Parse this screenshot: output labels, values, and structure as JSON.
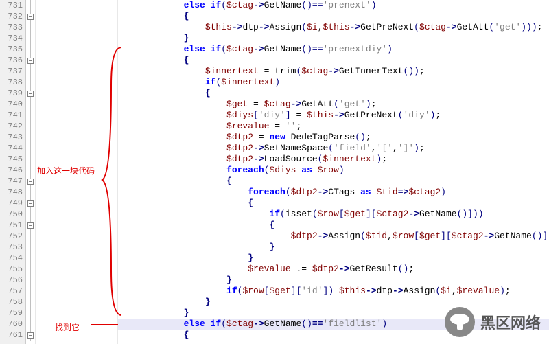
{
  "annotations": {
    "add_block": "加入这一块代码",
    "found_it": "找到它"
  },
  "watermark": "黑区网络",
  "line_numbers": [
    731,
    732,
    733,
    734,
    735,
    736,
    737,
    738,
    739,
    740,
    741,
    742,
    743,
    744,
    745,
    746,
    747,
    748,
    749,
    750,
    751,
    752,
    753,
    754,
    755,
    756,
    757,
    758,
    759,
    760,
    761
  ],
  "lines": [
    {
      "n": 731,
      "indent": 3,
      "tokens": [
        [
          "kw",
          "else if"
        ],
        [
          "paren",
          "("
        ],
        [
          "var",
          "$ctag"
        ],
        [
          "op",
          "->"
        ],
        [
          "func",
          "GetName"
        ],
        [
          "paren",
          "()"
        ],
        [
          "op",
          "=="
        ],
        [
          "str",
          "'prenext'"
        ],
        [
          "paren",
          ")"
        ]
      ]
    },
    {
      "n": 732,
      "indent": 3,
      "tokens": [
        [
          "brace",
          "{"
        ]
      ]
    },
    {
      "n": 733,
      "indent": 4,
      "tokens": [
        [
          "var",
          "$this"
        ],
        [
          "op",
          "->"
        ],
        [
          "func",
          "dtp"
        ],
        [
          "op",
          "->"
        ],
        [
          "func",
          "Assign"
        ],
        [
          "paren",
          "("
        ],
        [
          "var",
          "$i"
        ],
        [
          "norm",
          ","
        ],
        [
          "var",
          "$this"
        ],
        [
          "op",
          "->"
        ],
        [
          "func",
          "GetPreNext"
        ],
        [
          "paren",
          "("
        ],
        [
          "var",
          "$ctag"
        ],
        [
          "op",
          "->"
        ],
        [
          "func",
          "GetAtt"
        ],
        [
          "paren",
          "("
        ],
        [
          "str",
          "'get'"
        ],
        [
          "paren",
          ")))"
        ],
        [
          "norm",
          ";"
        ]
      ]
    },
    {
      "n": 734,
      "indent": 3,
      "tokens": [
        [
          "brace",
          "}"
        ]
      ]
    },
    {
      "n": 735,
      "indent": 3,
      "tokens": [
        [
          "kw",
          "else if"
        ],
        [
          "paren",
          "("
        ],
        [
          "var",
          "$ctag"
        ],
        [
          "op",
          "->"
        ],
        [
          "func",
          "GetName"
        ],
        [
          "paren",
          "()"
        ],
        [
          "op",
          "=="
        ],
        [
          "str",
          "'prenextdiy'"
        ],
        [
          "paren",
          ")"
        ]
      ]
    },
    {
      "n": 736,
      "indent": 3,
      "tokens": [
        [
          "brace",
          "{"
        ]
      ]
    },
    {
      "n": 737,
      "indent": 4,
      "tokens": [
        [
          "var",
          "$innertext"
        ],
        [
          "norm",
          " = "
        ],
        [
          "func",
          "trim"
        ],
        [
          "paren",
          "("
        ],
        [
          "var",
          "$ctag"
        ],
        [
          "op",
          "->"
        ],
        [
          "func",
          "GetInnerText"
        ],
        [
          "paren",
          "())"
        ],
        [
          "norm",
          ";"
        ]
      ]
    },
    {
      "n": 738,
      "indent": 4,
      "tokens": [
        [
          "kw",
          "if"
        ],
        [
          "paren",
          "("
        ],
        [
          "var",
          "$innertext"
        ],
        [
          "paren",
          ")"
        ]
      ]
    },
    {
      "n": 739,
      "indent": 4,
      "tokens": [
        [
          "brace",
          "{"
        ]
      ]
    },
    {
      "n": 740,
      "indent": 5,
      "tokens": [
        [
          "var",
          "$get"
        ],
        [
          "norm",
          " = "
        ],
        [
          "var",
          "$ctag"
        ],
        [
          "op",
          "->"
        ],
        [
          "func",
          "GetAtt"
        ],
        [
          "paren",
          "("
        ],
        [
          "str",
          "'get'"
        ],
        [
          "paren",
          ")"
        ],
        [
          "norm",
          ";"
        ]
      ]
    },
    {
      "n": 741,
      "indent": 5,
      "tokens": [
        [
          "var",
          "$diys"
        ],
        [
          "paren",
          "["
        ],
        [
          "str",
          "'diy'"
        ],
        [
          "paren",
          "]"
        ],
        [
          "norm",
          " = "
        ],
        [
          "var",
          "$this"
        ],
        [
          "op",
          "->"
        ],
        [
          "func",
          "GetPreNext"
        ],
        [
          "paren",
          "("
        ],
        [
          "str",
          "'diy'"
        ],
        [
          "paren",
          ")"
        ],
        [
          "norm",
          ";"
        ]
      ]
    },
    {
      "n": 742,
      "indent": 5,
      "tokens": [
        [
          "var",
          "$revalue"
        ],
        [
          "norm",
          " = "
        ],
        [
          "str",
          "''"
        ],
        [
          "norm",
          ";"
        ]
      ]
    },
    {
      "n": 743,
      "indent": 5,
      "tokens": [
        [
          "var",
          "$dtp2"
        ],
        [
          "norm",
          " = "
        ],
        [
          "kw",
          "new"
        ],
        [
          "norm",
          " "
        ],
        [
          "func",
          "DedeTagParse"
        ],
        [
          "paren",
          "()"
        ],
        [
          "norm",
          ";"
        ]
      ]
    },
    {
      "n": 744,
      "indent": 5,
      "tokens": [
        [
          "var",
          "$dtp2"
        ],
        [
          "op",
          "->"
        ],
        [
          "func",
          "SetNameSpace"
        ],
        [
          "paren",
          "("
        ],
        [
          "str",
          "'field'"
        ],
        [
          "norm",
          ","
        ],
        [
          "str",
          "'['"
        ],
        [
          "norm",
          ","
        ],
        [
          "str",
          "']'"
        ],
        [
          "paren",
          ")"
        ],
        [
          "norm",
          ";"
        ]
      ]
    },
    {
      "n": 745,
      "indent": 5,
      "tokens": [
        [
          "var",
          "$dtp2"
        ],
        [
          "op",
          "->"
        ],
        [
          "func",
          "LoadSource"
        ],
        [
          "paren",
          "("
        ],
        [
          "var",
          "$innertext"
        ],
        [
          "paren",
          ")"
        ],
        [
          "norm",
          ";"
        ]
      ]
    },
    {
      "n": 746,
      "indent": 5,
      "tokens": [
        [
          "kw",
          "foreach"
        ],
        [
          "paren",
          "("
        ],
        [
          "var",
          "$diys"
        ],
        [
          "norm",
          " "
        ],
        [
          "kw",
          "as"
        ],
        [
          "norm",
          " "
        ],
        [
          "var",
          "$row"
        ],
        [
          "paren",
          ")"
        ]
      ]
    },
    {
      "n": 747,
      "indent": 5,
      "tokens": [
        [
          "brace",
          "{"
        ]
      ]
    },
    {
      "n": 748,
      "indent": 6,
      "tokens": [
        [
          "kw",
          "foreach"
        ],
        [
          "paren",
          "("
        ],
        [
          "var",
          "$dtp2"
        ],
        [
          "op",
          "->"
        ],
        [
          "func",
          "CTags"
        ],
        [
          "norm",
          " "
        ],
        [
          "kw",
          "as"
        ],
        [
          "norm",
          " "
        ],
        [
          "var",
          "$tid"
        ],
        [
          "op",
          "=>"
        ],
        [
          "var",
          "$ctag2"
        ],
        [
          "paren",
          ")"
        ]
      ]
    },
    {
      "n": 749,
      "indent": 6,
      "tokens": [
        [
          "brace",
          "{"
        ]
      ]
    },
    {
      "n": 750,
      "indent": 7,
      "tokens": [
        [
          "kw",
          "if"
        ],
        [
          "paren",
          "("
        ],
        [
          "func",
          "isset"
        ],
        [
          "paren",
          "("
        ],
        [
          "var",
          "$row"
        ],
        [
          "paren",
          "["
        ],
        [
          "var",
          "$get"
        ],
        [
          "paren",
          "]["
        ],
        [
          "var",
          "$ctag2"
        ],
        [
          "op",
          "->"
        ],
        [
          "func",
          "GetName"
        ],
        [
          "paren",
          "()]))"
        ]
      ]
    },
    {
      "n": 751,
      "indent": 7,
      "tokens": [
        [
          "brace",
          "{"
        ]
      ]
    },
    {
      "n": 752,
      "indent": 8,
      "tokens": [
        [
          "var",
          "$dtp2"
        ],
        [
          "op",
          "->"
        ],
        [
          "func",
          "Assign"
        ],
        [
          "paren",
          "("
        ],
        [
          "var",
          "$tid"
        ],
        [
          "norm",
          ","
        ],
        [
          "var",
          "$row"
        ],
        [
          "paren",
          "["
        ],
        [
          "var",
          "$get"
        ],
        [
          "paren",
          "]["
        ],
        [
          "var",
          "$ctag2"
        ],
        [
          "op",
          "->"
        ],
        [
          "func",
          "GetName"
        ],
        [
          "paren",
          "()])"
        ],
        [
          "norm",
          ";"
        ]
      ]
    },
    {
      "n": 753,
      "indent": 7,
      "tokens": [
        [
          "brace",
          "}"
        ]
      ]
    },
    {
      "n": 754,
      "indent": 6,
      "tokens": [
        [
          "brace",
          "}"
        ]
      ]
    },
    {
      "n": 755,
      "indent": 6,
      "tokens": [
        [
          "var",
          "$revalue"
        ],
        [
          "norm",
          " .= "
        ],
        [
          "var",
          "$dtp2"
        ],
        [
          "op",
          "->"
        ],
        [
          "func",
          "GetResult"
        ],
        [
          "paren",
          "()"
        ],
        [
          "norm",
          ";"
        ]
      ]
    },
    {
      "n": 756,
      "indent": 5,
      "tokens": [
        [
          "brace",
          "}"
        ]
      ]
    },
    {
      "n": 757,
      "indent": 5,
      "tokens": [
        [
          "kw",
          "if"
        ],
        [
          "paren",
          "("
        ],
        [
          "var",
          "$row"
        ],
        [
          "paren",
          "["
        ],
        [
          "var",
          "$get"
        ],
        [
          "paren",
          "]["
        ],
        [
          "str",
          "'id'"
        ],
        [
          "paren",
          "])"
        ],
        [
          "norm",
          " "
        ],
        [
          "var",
          "$this"
        ],
        [
          "op",
          "->"
        ],
        [
          "func",
          "dtp"
        ],
        [
          "op",
          "->"
        ],
        [
          "func",
          "Assign"
        ],
        [
          "paren",
          "("
        ],
        [
          "var",
          "$i"
        ],
        [
          "norm",
          ","
        ],
        [
          "var",
          "$revalue"
        ],
        [
          "paren",
          ")"
        ],
        [
          "norm",
          ";"
        ]
      ]
    },
    {
      "n": 758,
      "indent": 4,
      "tokens": [
        [
          "brace",
          "}"
        ]
      ]
    },
    {
      "n": 759,
      "indent": 3,
      "tokens": [
        [
          "brace",
          "}"
        ]
      ]
    },
    {
      "n": 760,
      "indent": 3,
      "hl": true,
      "tokens": [
        [
          "kw",
          "else if"
        ],
        [
          "paren",
          "("
        ],
        [
          "var",
          "$ctag"
        ],
        [
          "op",
          "->"
        ],
        [
          "func",
          "GetName"
        ],
        [
          "paren",
          "()"
        ],
        [
          "op",
          "=="
        ],
        [
          "str",
          "'fieldlist'"
        ],
        [
          "paren",
          ")"
        ]
      ]
    },
    {
      "n": 761,
      "indent": 3,
      "tokens": [
        [
          "brace",
          "{"
        ]
      ]
    }
  ],
  "fold_markers": [
    732,
    736,
    739,
    747,
    749,
    751,
    761
  ]
}
